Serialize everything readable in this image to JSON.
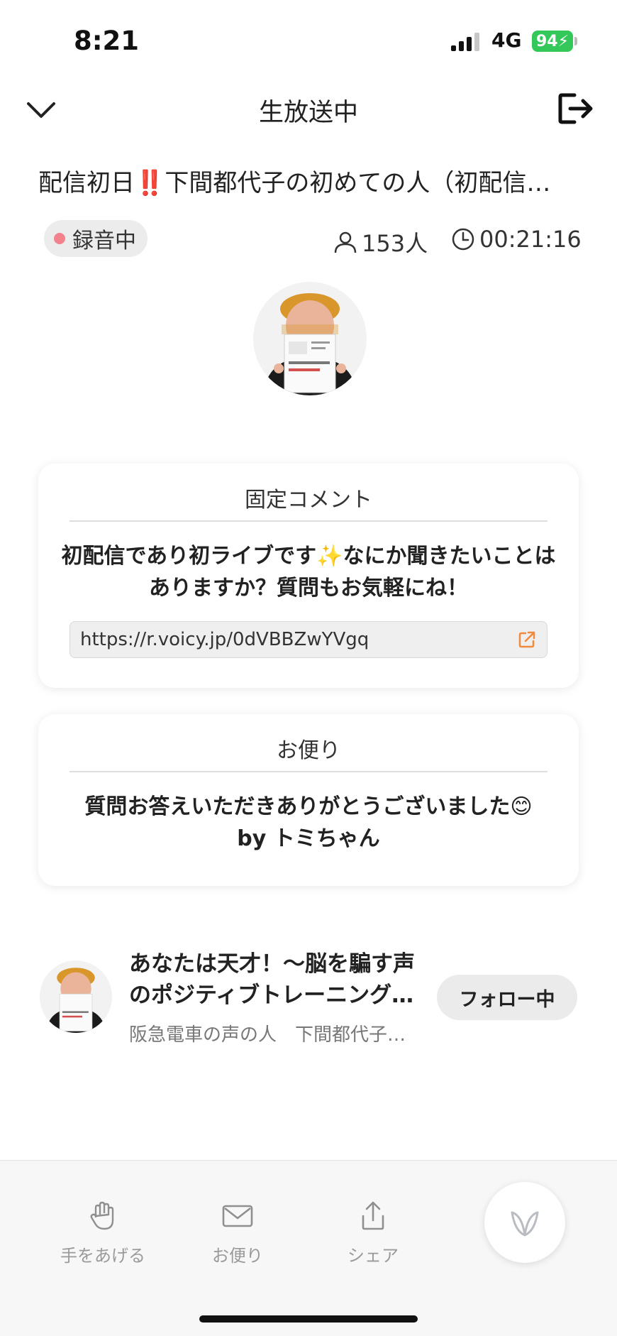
{
  "status_bar": {
    "time": "8:21",
    "network": "4G",
    "battery": "94"
  },
  "header": {
    "title": "生放送中"
  },
  "episode": {
    "title": "配信初日‼️下間都代子の初めての人（初配信…",
    "recording_label": "録音中",
    "listeners": "153人",
    "elapsed": "00:21:16"
  },
  "pinned_comment": {
    "heading": "固定コメント",
    "body": "初配信であり初ライブです✨なにか聞きたいことはありますか？質問もお気軽にね！",
    "url": "https://r.voicy.jp/0dVBBZwYVgq"
  },
  "letter": {
    "heading": "お便り",
    "body_line1": "質問お答えいただきありがとうございました😊",
    "body_line2": "by トミちゃん"
  },
  "channel": {
    "name": "あなたは天才！〜脳を騙す声のポジティブトレーニング…",
    "subtitle": "阪急電車の声の人　下間都代子…",
    "follow_label": "フォロー中"
  },
  "bottom_bar": {
    "items": [
      {
        "label": "手をあげる",
        "icon": "raise-hand-icon"
      },
      {
        "label": "お便り",
        "icon": "mail-icon"
      },
      {
        "label": "シェア",
        "icon": "share-icon"
      }
    ],
    "fab_icon": "leaf-icon"
  },
  "colors": {
    "battery": "#34c759",
    "recording_dot": "#f4828c",
    "link_icon": "#f08a3c",
    "leaf": "#b9bcc0"
  }
}
